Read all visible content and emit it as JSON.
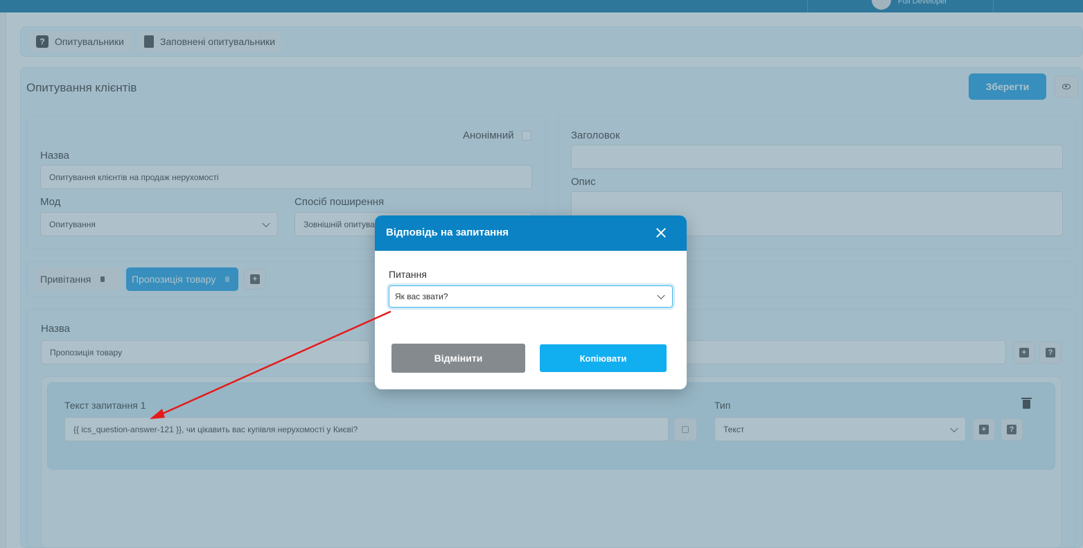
{
  "header": {
    "user_name": "Full Developer"
  },
  "nav": {
    "questionnaires_label": "Опитувальники",
    "filled_questionnaires_label": "Заповнені опитувальники"
  },
  "survey": {
    "title": "Опитування клієнтів",
    "save_label": "Зберегти",
    "anonymous_label": "Анонімний",
    "name_label": "Назва",
    "name_value": "Опитування клієнтів на продаж нерухомості",
    "mode_label": "Мод",
    "mode_value": "Опитування",
    "distribution_label": "Спосіб поширення",
    "distribution_value": "Зовнішній опитувальник",
    "heading_label": "Заголовок",
    "heading_value": "",
    "description_label": "Опис",
    "description_value": ""
  },
  "tabs": [
    {
      "label": "Привітання",
      "active": false
    },
    {
      "label": "Пропозиція товару",
      "active": true
    }
  ],
  "section": {
    "name_label": "Назва",
    "name_value": "Пропозиція товару"
  },
  "question": {
    "text_label": "Текст запитання 1",
    "text_value": "{{ ics_question-answer-121 }}, чи цікавить вас купівля нерухомості у Києві?",
    "type_label": "Тип",
    "type_value": "Текст"
  },
  "modal": {
    "title": "Відповідь на запитання",
    "question_label": "Питання",
    "question_value": "Як вас звати?",
    "cancel_label": "Відмінити",
    "copy_label": "Копіювати"
  },
  "colors": {
    "primary": "#1ea0e6",
    "header": "#0a82c4",
    "cancel": "#858a8f",
    "arrow": "#e41b1b"
  }
}
